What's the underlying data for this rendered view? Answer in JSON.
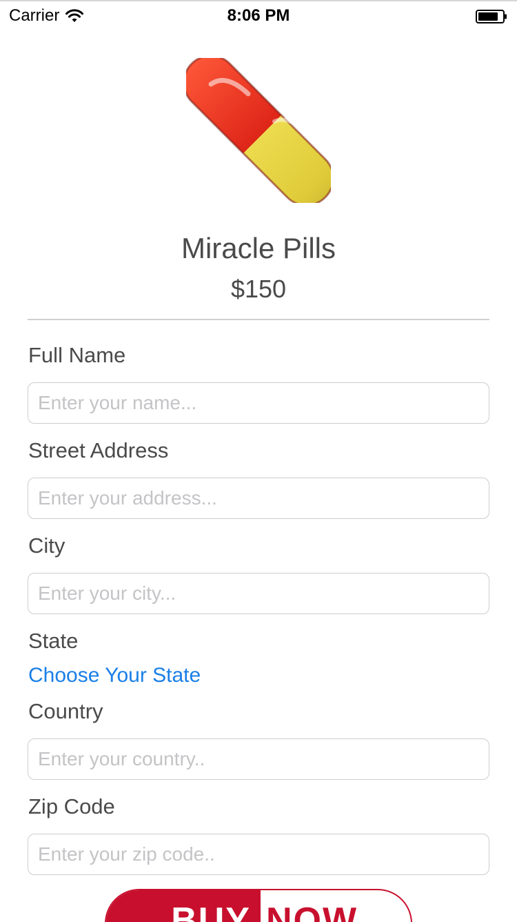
{
  "status_bar": {
    "carrier": "Carrier",
    "time": "8:06 PM",
    "icons": [
      "wifi-icon",
      "battery-icon"
    ]
  },
  "product": {
    "image_icon": "pill-icon",
    "name": "Miracle Pills",
    "price": "$150"
  },
  "form": {
    "full_name": {
      "label": "Full Name",
      "placeholder": "Enter your name...",
      "value": ""
    },
    "street_address": {
      "label": "Street Address",
      "placeholder": "Enter your address...",
      "value": ""
    },
    "city": {
      "label": "City",
      "placeholder": "Enter your city...",
      "value": ""
    },
    "state": {
      "label": "State",
      "selector_text": "Choose Your State"
    },
    "country": {
      "label": "Country",
      "placeholder": "Enter your country..",
      "value": ""
    },
    "zip_code": {
      "label": "Zip Code",
      "placeholder": "Enter your zip code..",
      "value": ""
    }
  },
  "buy_button": {
    "left_text": "BUY",
    "right_text": "NOW"
  },
  "colors": {
    "accent_blue": "#1a7fe6",
    "brand_red": "#c8102e",
    "text_gray": "#4a4a4a"
  }
}
